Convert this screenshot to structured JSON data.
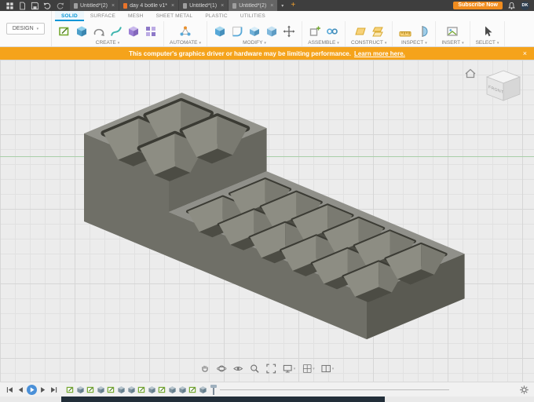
{
  "titlebar": {
    "documents": [
      {
        "label": "Untitled*(2)",
        "active": false,
        "icon_color": "#9E9E9E"
      },
      {
        "label": "day 4 botlle v1*",
        "active": false,
        "icon_color": "#E8732A"
      },
      {
        "label": "Untitled*(1)",
        "active": false,
        "icon_color": "#9E9E9E"
      },
      {
        "label": "Untitled*(2)",
        "active": true,
        "icon_color": "#9E9E9E"
      }
    ],
    "new_tab_label": "+",
    "subscribe_label": "Subscribe Now",
    "avatar_initials": "DK"
  },
  "ribbon": {
    "design_label": "DESIGN",
    "tabs": [
      {
        "label": "SOLID",
        "active": true
      },
      {
        "label": "SURFACE",
        "active": false
      },
      {
        "label": "MESH",
        "active": false
      },
      {
        "label": "SHEET METAL",
        "active": false
      },
      {
        "label": "PLASTIC",
        "active": false
      },
      {
        "label": "UTILITIES",
        "active": false
      }
    ],
    "groups": [
      {
        "label": "CREATE",
        "icons": [
          "sketch-icon",
          "extrude-icon",
          "revolve-icon",
          "sweep-icon",
          "loft-icon",
          "pattern-icon"
        ]
      },
      {
        "label": "AUTOMATE",
        "icons": [
          "automate-icon"
        ]
      },
      {
        "label": "MODIFY",
        "icons": [
          "press-pull-icon",
          "fillet-icon",
          "shell-icon",
          "combine-icon",
          "move-icon"
        ]
      },
      {
        "label": "ASSEMBLE",
        "icons": [
          "component-icon",
          "joint-icon"
        ]
      },
      {
        "label": "CONSTRUCT",
        "icons": [
          "plane-icon",
          "offset-plane-icon"
        ]
      },
      {
        "label": "INSPECT",
        "icons": [
          "measure-icon",
          "section-icon"
        ]
      },
      {
        "label": "INSERT",
        "icons": [
          "decal-icon"
        ]
      },
      {
        "label": "SELECT",
        "icons": [
          "select-icon"
        ]
      }
    ]
  },
  "banner": {
    "message": "This computer's graphics driver or hardware may be limiting performance.",
    "link_label": "Learn more here."
  },
  "viewport": {
    "viewcube_label": "FRONT"
  },
  "nav_toolbar": {
    "items": [
      {
        "name": "pan-icon",
        "dropdown": false
      },
      {
        "name": "orbit-icon",
        "dropdown": false
      },
      {
        "name": "look-at-icon",
        "dropdown": false
      },
      {
        "name": "zoom-icon",
        "dropdown": false
      },
      {
        "name": "fit-icon",
        "dropdown": false
      },
      {
        "name": "display-settings-icon",
        "dropdown": true
      },
      {
        "name": "grid-settings-icon",
        "dropdown": true
      },
      {
        "name": "viewports-icon",
        "dropdown": true
      }
    ]
  },
  "timeline": {
    "controls": [
      "skip-start-icon",
      "step-back-icon",
      "play-icon",
      "step-forward-icon",
      "skip-end-icon"
    ],
    "features": [
      "sketch-feature-icon",
      "extrude-feature-icon",
      "sketch-feature-icon",
      "extrude-feature-icon",
      "sketch-feature-icon",
      "extrude-feature-icon",
      "extrude-feature-icon",
      "sketch-feature-icon",
      "extrude-feature-icon",
      "sketch-feature-icon",
      "extrude-feature-icon",
      "extrude-feature-icon",
      "sketch-feature-icon",
      "extrude-feature-icon"
    ]
  },
  "colors": {
    "accent": "#0696D7",
    "banner_bg": "#F5A31B",
    "subscribe_bg": "#F08C1F"
  }
}
